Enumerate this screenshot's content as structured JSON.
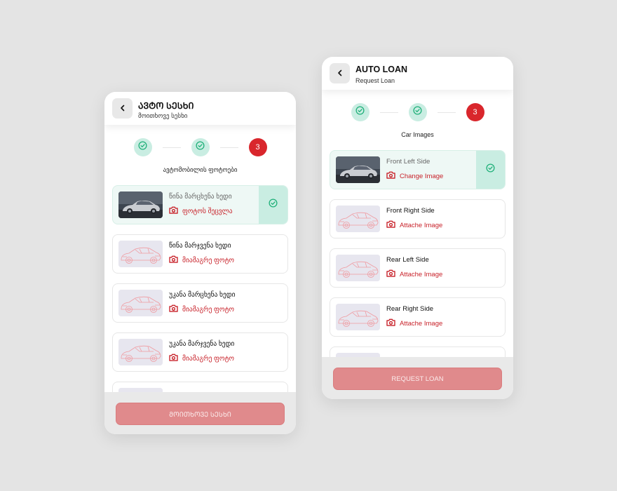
{
  "colors": {
    "accent_red": "#d9262c",
    "success_green": "#1fb079",
    "success_bg": "#c9ede2",
    "cta_disabled": "#e08a8c"
  },
  "screens": [
    {
      "header": {
        "title": "ᲐᲕᲢᲝ ᲡᲔᲡᲮᲘ",
        "subtitle": "მოითხოვე სესხი",
        "back_icon": "chevron-left-icon"
      },
      "steps": [
        {
          "state": "done",
          "icon": "check-circle-icon"
        },
        {
          "state": "done",
          "icon": "check-circle-icon"
        },
        {
          "state": "active",
          "label": "3"
        }
      ],
      "step_label": "ავტომობილის ფოტოები",
      "items": [
        {
          "title": "წინა მარცხენა ხედი",
          "action": "ფოტოს შეცვლა",
          "status": "completed"
        },
        {
          "title": "წინა მარჯვენა ხედი",
          "action": "მიამაგრე ფოტო",
          "status": "empty"
        },
        {
          "title": "უკანა მარცხენა ხედი",
          "action": "მიამაგრე ფოტო",
          "status": "empty"
        },
        {
          "title": "უკანა მარჯვენა ხედი",
          "action": "მიამაგრე ფოტო",
          "status": "empty"
        },
        {
          "title": "",
          "action": "",
          "status": "empty"
        }
      ],
      "cta": "ᲛᲝᲘᲗᲮᲝᲕᲔ ᲡᲔᲡᲮᲘ"
    },
    {
      "header": {
        "title": "AUTO LOAN",
        "subtitle": "Request Loan",
        "back_icon": "chevron-left-icon"
      },
      "steps": [
        {
          "state": "done",
          "icon": "check-circle-icon"
        },
        {
          "state": "done",
          "icon": "check-circle-icon"
        },
        {
          "state": "active",
          "label": "3"
        }
      ],
      "step_label": "Car Images",
      "items": [
        {
          "title": "Front Left Side",
          "action": "Change Image",
          "status": "completed"
        },
        {
          "title": "Front Right Side",
          "action": "Attache Image",
          "status": "empty"
        },
        {
          "title": "Rear Left Side",
          "action": "Attache Image",
          "status": "empty"
        },
        {
          "title": "Rear Right Side",
          "action": "Attache Image",
          "status": "empty"
        },
        {
          "title": "",
          "action": "",
          "status": "empty"
        }
      ],
      "cta": "REQUEST LOAN"
    }
  ]
}
